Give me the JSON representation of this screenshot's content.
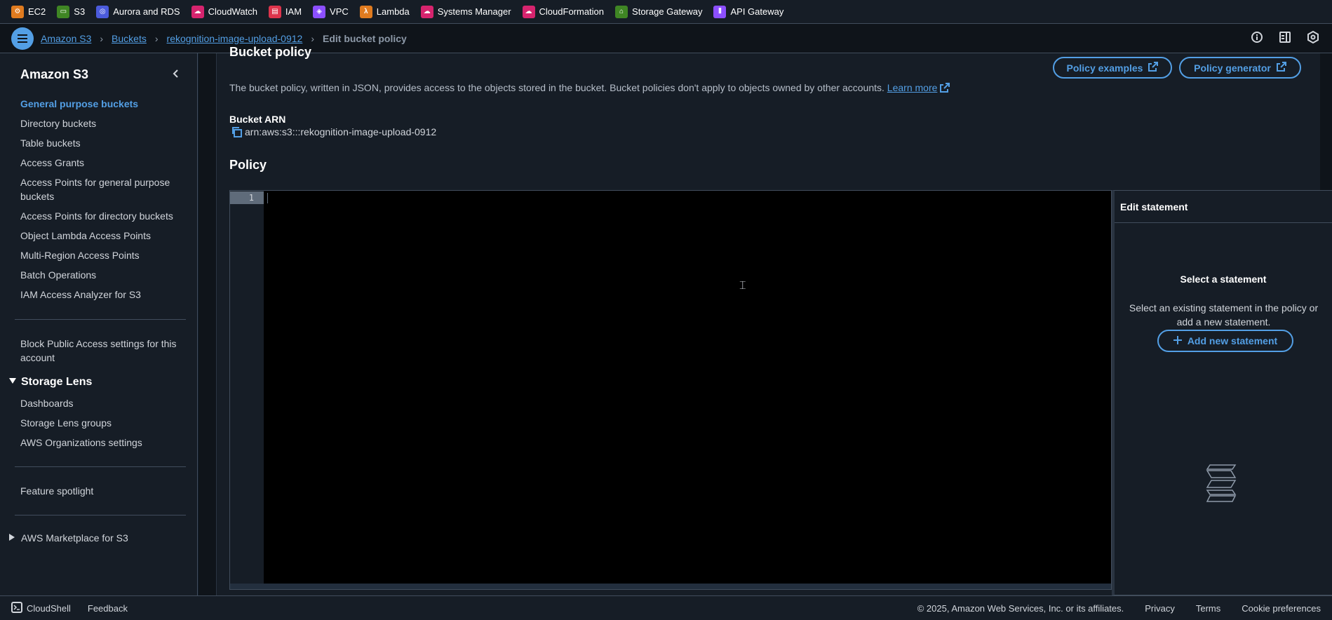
{
  "favorites": [
    {
      "label": "EC2",
      "color": "#e07b1f",
      "icon": "ec2-icon"
    },
    {
      "label": "S3",
      "color": "#3f8624",
      "icon": "s3-icon"
    },
    {
      "label": "Aurora and RDS",
      "color": "#4b5bdc",
      "icon": "rds-icon"
    },
    {
      "label": "CloudWatch",
      "color": "#d6246e",
      "icon": "cloudwatch-icon"
    },
    {
      "label": "IAM",
      "color": "#dd344c",
      "icon": "iam-icon"
    },
    {
      "label": "VPC",
      "color": "#8c4fff",
      "icon": "vpc-icon"
    },
    {
      "label": "Lambda",
      "color": "#e07b1f",
      "icon": "lambda-icon"
    },
    {
      "label": "Systems Manager",
      "color": "#d6246e",
      "icon": "systems-manager-icon"
    },
    {
      "label": "CloudFormation",
      "color": "#d6246e",
      "icon": "cloudformation-icon"
    },
    {
      "label": "Storage Gateway",
      "color": "#3f8624",
      "icon": "storage-gateway-icon"
    },
    {
      "label": "API Gateway",
      "color": "#8c4fff",
      "icon": "api-gateway-icon"
    }
  ],
  "breadcrumb": {
    "items": [
      "Amazon S3",
      "Buckets",
      "rekognition-image-upload-0912"
    ],
    "current": "Edit bucket policy"
  },
  "sidebar": {
    "title": "Amazon S3",
    "items": [
      "General purpose buckets",
      "Directory buckets",
      "Table buckets",
      "Access Grants",
      "Access Points for general purpose buckets",
      "Access Points for directory buckets",
      "Object Lambda Access Points",
      "Multi-Region Access Points",
      "Batch Operations",
      "IAM Access Analyzer for S3"
    ],
    "block_public_access": "Block Public Access settings for this account",
    "storage_lens": {
      "title": "Storage Lens",
      "items": [
        "Dashboards",
        "Storage Lens groups",
        "AWS Organizations settings"
      ]
    },
    "feature_spotlight": "Feature spotlight",
    "marketplace": "AWS Marketplace for S3"
  },
  "main": {
    "heading": "Bucket policy",
    "policy_examples": "Policy examples",
    "policy_generator": "Policy generator",
    "description": "The bucket policy, written in JSON, provides access to the objects stored in the bucket. Bucket policies don't apply to objects owned by other accounts.",
    "learn_more": "Learn more",
    "arn_label": "Bucket ARN",
    "arn_value": "arn:aws:s3:::rekognition-image-upload-0912",
    "policy_label": "Policy",
    "line_number": "1"
  },
  "statement_panel": {
    "title": "Edit statement",
    "empty_title": "Select a statement",
    "empty_text": "Select an existing statement in the policy or add a new statement.",
    "add_button": "Add new statement"
  },
  "footer": {
    "cloudshell": "CloudShell",
    "feedback": "Feedback",
    "copyright": "© 2025, Amazon Web Services, Inc. or its affiliates.",
    "privacy": "Privacy",
    "terms": "Terms",
    "cookies": "Cookie preferences"
  },
  "colors": {
    "accent": "#539fe5",
    "background": "#0f141a",
    "panel": "#161d26"
  }
}
